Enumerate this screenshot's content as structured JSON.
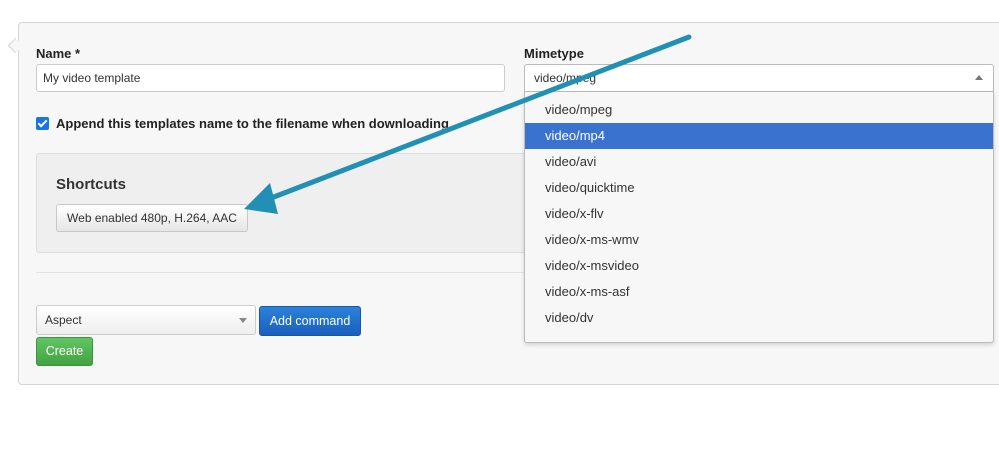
{
  "form": {
    "name_label": "Name *",
    "name_value": "My video template",
    "mimetype_label": "Mimetype",
    "mimetype_value": "video/mpeg",
    "append_checked": true,
    "append_label": "Append this templates name to the filename when downloading"
  },
  "shortcuts": {
    "title": "Shortcuts",
    "button_label": "Web enabled 480p, H.264, AAC"
  },
  "commands": {
    "select_value": "Aspect",
    "add_button": "Add command",
    "create_button": "Create"
  },
  "mimetype_dropdown": {
    "options": [
      "video/mpeg",
      "video/mp4",
      "video/avi",
      "video/quicktime",
      "video/x-flv",
      "video/x-ms-wmv",
      "video/x-msvideo",
      "video/x-ms-asf",
      "video/dv"
    ],
    "highlighted": "video/mp4"
  },
  "colors": {
    "annotation_arrow": "#2190b4",
    "highlight": "#3a72d0",
    "primary_button": "#1b5fbf",
    "success_button": "#43a343",
    "checkbox": "#1a73e8"
  },
  "icons": {
    "checkbox": "check-icon",
    "mime_caret": "caret-up-icon",
    "aspect_caret": "caret-down-icon",
    "annotation": "arrow-annotation-icon"
  }
}
